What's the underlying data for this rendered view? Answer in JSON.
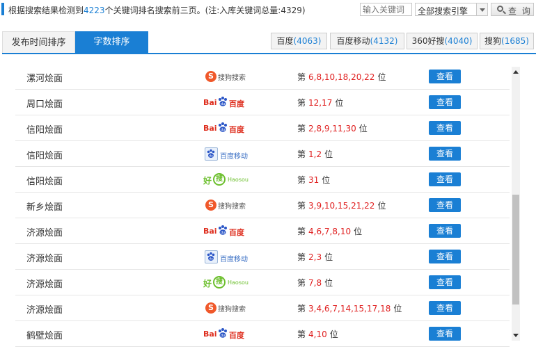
{
  "summary": {
    "prefix": "根据搜索结果检测到",
    "count": "4223",
    "suffix": "个关键词排名搜索前三页。(注:入库关键词总量:4329)"
  },
  "search": {
    "placeholder": "输入关键词",
    "engine_value": "全部搜索引擎",
    "button_label": "查 询"
  },
  "tabs": [
    {
      "label": "发布时间排序",
      "active": false
    },
    {
      "label": "字数排序",
      "active": true
    }
  ],
  "engine_tabs": [
    {
      "name": "百度",
      "count": "(4063)"
    },
    {
      "name": "百度移动",
      "count": "(4132)"
    },
    {
      "name": "360好搜",
      "count": "(4040)"
    },
    {
      "name": "搜狗",
      "count": "(1685)"
    }
  ],
  "logo_text": {
    "sogou_mark": "S",
    "sogou": "搜狗搜索",
    "baidu_bai": "Bai",
    "baidu": "百度",
    "baidu_mobile": "百度移动",
    "haosou_hao": "好",
    "haosou_circle": "搜",
    "haosou": "Haosou"
  },
  "rank_prefix": "第",
  "rank_suffix": "位",
  "view_label": "查看",
  "rows": [
    {
      "keyword": "漯河烩面",
      "engine": "sogou",
      "positions": "6,8,10,18,20,22"
    },
    {
      "keyword": "周口烩面",
      "engine": "baidu",
      "positions": "12,17"
    },
    {
      "keyword": "信阳烩面",
      "engine": "baidu",
      "positions": "2,8,9,11,30"
    },
    {
      "keyword": "信阳烩面",
      "engine": "baidu_mobile",
      "positions": "1,2"
    },
    {
      "keyword": "信阳烩面",
      "engine": "haosou",
      "positions": "31"
    },
    {
      "keyword": "新乡烩面",
      "engine": "sogou",
      "positions": "3,9,10,15,21,22"
    },
    {
      "keyword": "济源烩面",
      "engine": "baidu",
      "positions": "4,6,7,8,10"
    },
    {
      "keyword": "济源烩面",
      "engine": "baidu_mobile",
      "positions": "2,3"
    },
    {
      "keyword": "济源烩面",
      "engine": "haosou",
      "positions": "7,8"
    },
    {
      "keyword": "济源烩面",
      "engine": "sogou",
      "positions": "3,4,6,7,14,15,17,18"
    },
    {
      "keyword": "鹤壁烩面",
      "engine": "baidu",
      "positions": "4,10"
    }
  ],
  "colors": {
    "accent": "#1a7fd4",
    "rank": "#e02020"
  }
}
